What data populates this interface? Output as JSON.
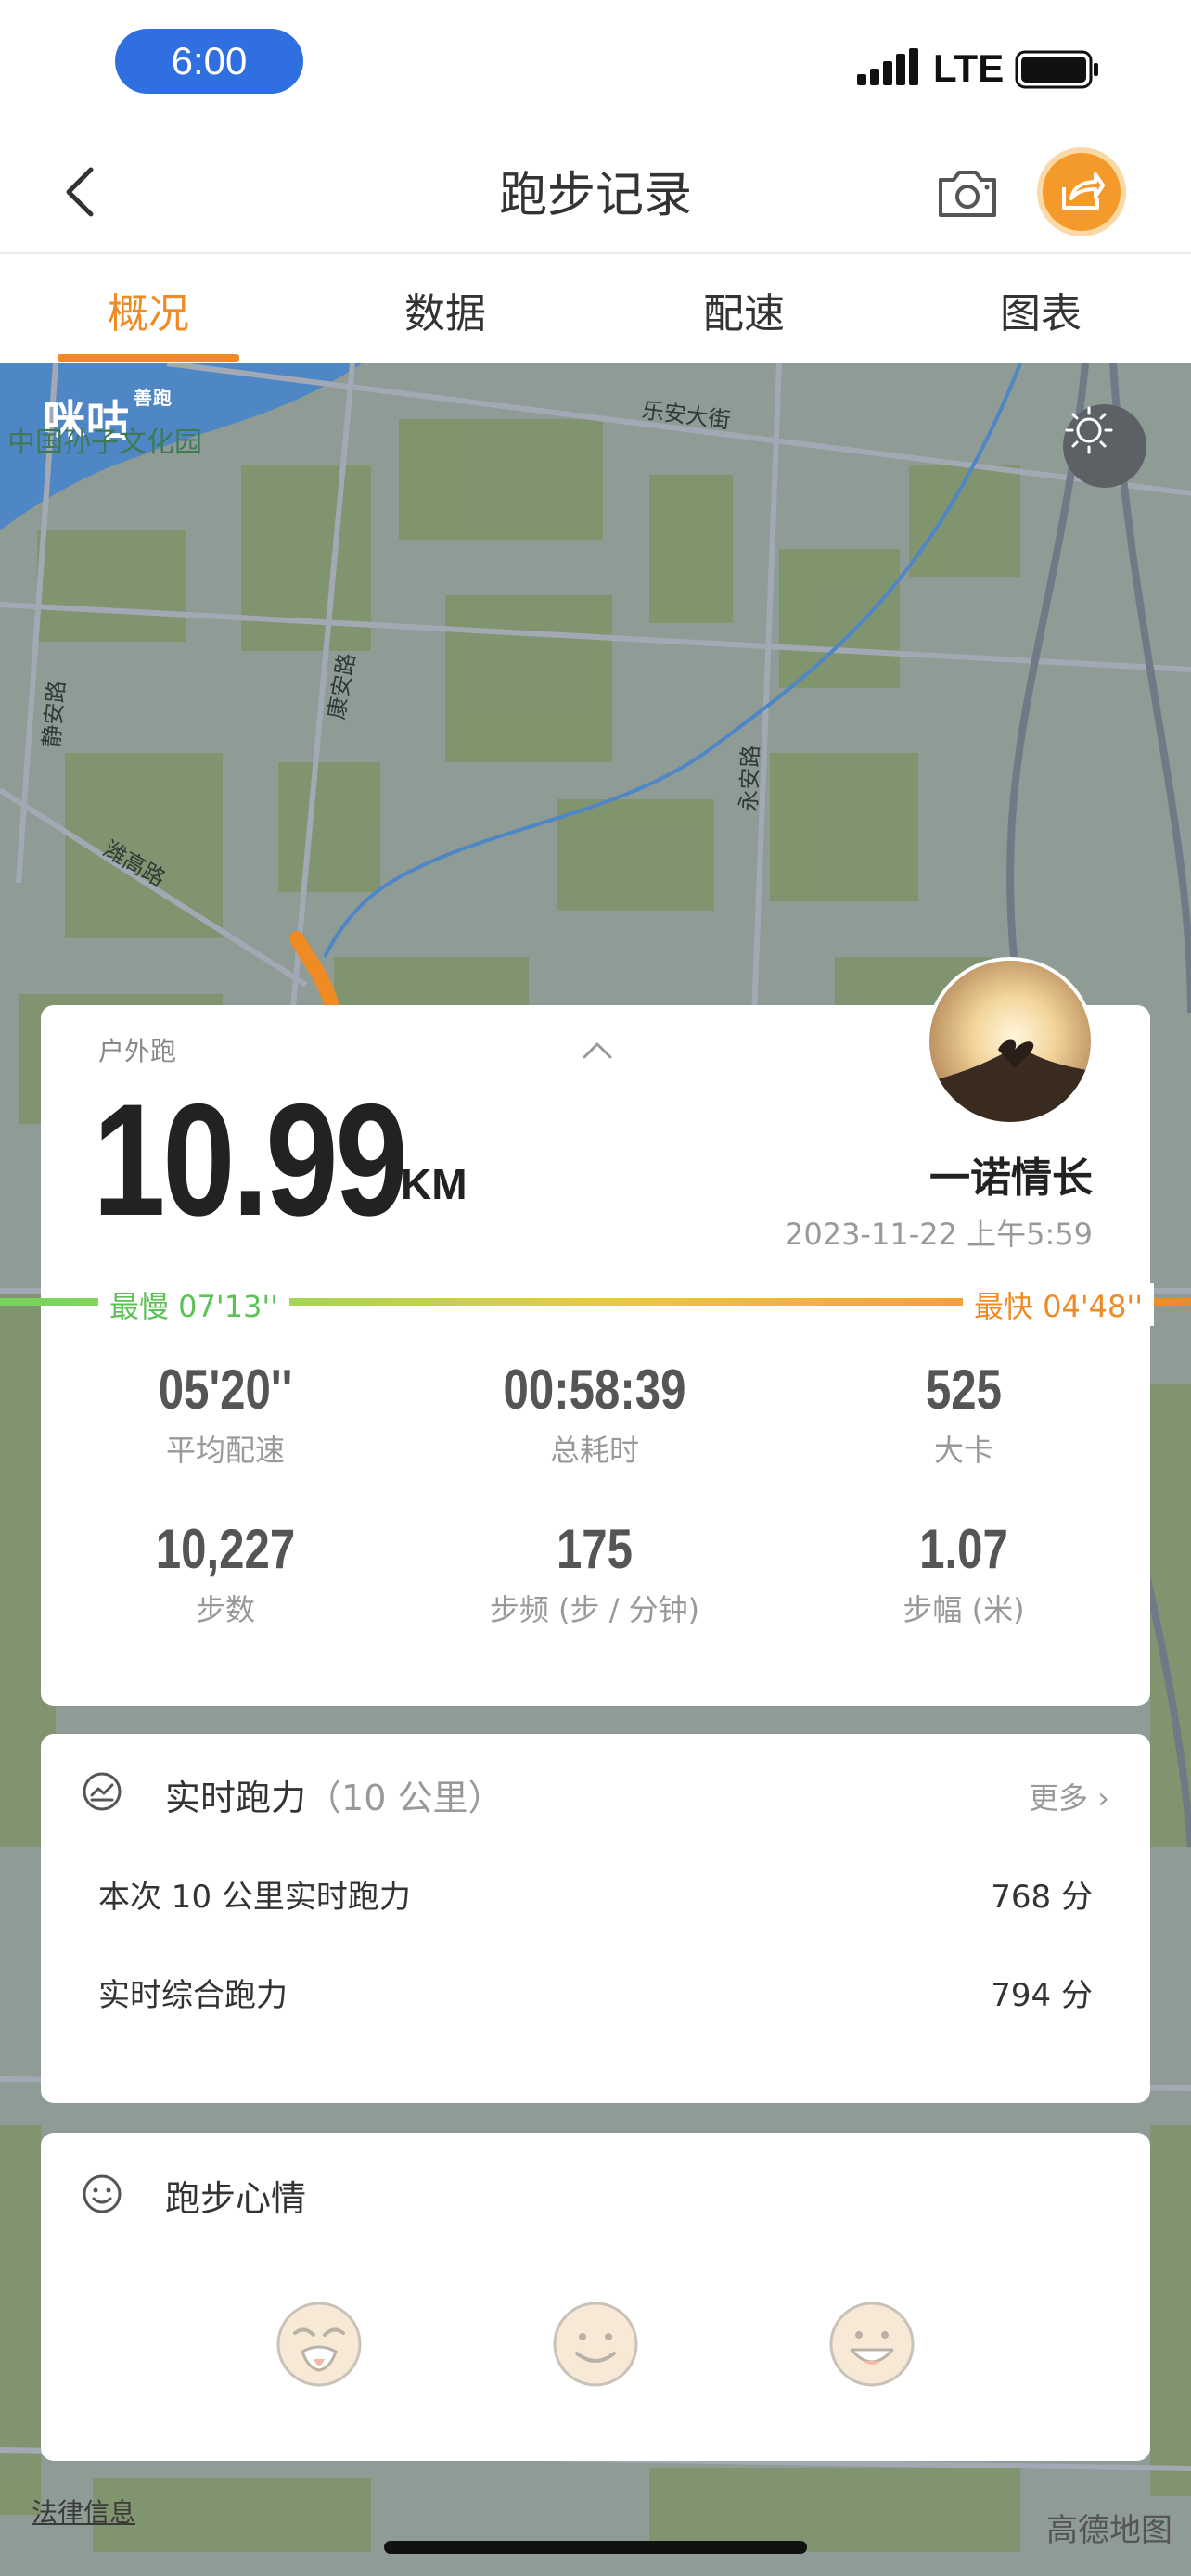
{
  "status_bar": {
    "time": "6:00",
    "network": "LTE"
  },
  "nav": {
    "title": "跑步记录"
  },
  "tabs": [
    {
      "label": "概况"
    },
    {
      "label": "数据"
    },
    {
      "label": "配速"
    },
    {
      "label": "图表"
    }
  ],
  "map": {
    "brand": "咪咕",
    "brand_sub": "善跑",
    "poi": "中国孙子文化园",
    "roads": [
      "乐安大街",
      "康安路",
      "静安路",
      "永安路",
      "潍高路"
    ],
    "legal": "法律信息",
    "attribution": "高德地图"
  },
  "summary": {
    "run_type": "户外跑",
    "distance": "10.99",
    "distance_unit": "KM",
    "username": "一诺情长",
    "date": "2023-11-22 上午5:59",
    "pace_slowest": "最慢  07'13''",
    "pace_fastest": "最快  04'48''",
    "stats": [
      {
        "value": "05'20''",
        "label": "平均配速"
      },
      {
        "value": "00:58:39",
        "label": "总耗时"
      },
      {
        "value": "525",
        "label": "大卡"
      },
      {
        "value": "10,227",
        "label": "步数"
      },
      {
        "value": "175",
        "label": "步频 (步 / 分钟)"
      },
      {
        "value": "1.07",
        "label": "步幅 (米)"
      }
    ]
  },
  "power": {
    "title": "实时跑力",
    "subtitle": "（10 公里）",
    "more": "更多",
    "rows": [
      {
        "label": "本次 10 公里实时跑力",
        "value": "768 分"
      },
      {
        "label": "实时综合跑力",
        "value": "794 分"
      }
    ]
  },
  "mood": {
    "title": "跑步心情"
  },
  "colors": {
    "accent": "#f08a24",
    "slow": "#5dc255",
    "status_pill": "#2f6fe0"
  }
}
